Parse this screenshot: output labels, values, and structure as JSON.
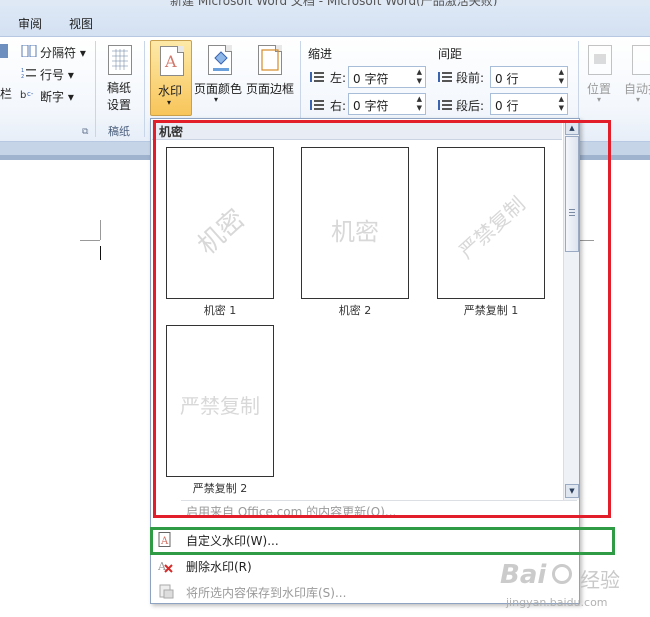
{
  "window": {
    "title": "新建 Microsoft Word 文档 - Microsoft Word(产品激活失败)"
  },
  "tabs": [
    {
      "label": "审阅"
    },
    {
      "label": "视图"
    }
  ],
  "ribbon": {
    "page_setup": {
      "breaks_label": "分隔符",
      "line_numbers_label": "行号",
      "hyphenation_label": "断字",
      "left_fragment": "栏"
    },
    "manuscript": {
      "button_line1": "稿纸",
      "button_line2": "设置",
      "group_label": "稿纸"
    },
    "page_background": {
      "watermark_label": "水印",
      "page_color_label": "页面颜色",
      "page_borders_label": "页面边框"
    },
    "paragraph": {
      "indent_title": "缩进",
      "indent_left_label": "左:",
      "indent_left_value": "0 字符",
      "indent_right_label": "右:",
      "indent_right_value": "0 字符",
      "spacing_title": "间距",
      "spacing_before_label": "段前:",
      "spacing_before_value": "0 行",
      "spacing_after_label": "段后:",
      "spacing_after_value": "0 行"
    },
    "arrange": {
      "position_label": "位置",
      "wrap_label": "自动换"
    }
  },
  "watermark_menu": {
    "section_title": "机密",
    "gallery": [
      {
        "watermark_text": "机密",
        "label": "机密 1",
        "style": "diagonal"
      },
      {
        "watermark_text": "机密",
        "label": "机密 2",
        "style": "horizontal"
      },
      {
        "watermark_text": "严禁复制",
        "label": "严禁复制 1",
        "style": "diagonal"
      },
      {
        "watermark_text": "严禁复制",
        "label": "严禁复制 2",
        "style": "horizontal"
      }
    ],
    "items": [
      {
        "label": "启用来自 Office.com 的内容更新(O)...",
        "enabled": false
      },
      {
        "label": "自定义水印(W)...",
        "enabled": true
      },
      {
        "label": "删除水印(R)",
        "enabled": true
      },
      {
        "label": "将所选内容保存到水印库(S)...",
        "enabled": false
      }
    ]
  },
  "site_watermark": {
    "brand": "Bai",
    "brand_cn": "经验",
    "url": "jingyan.baidu.com"
  },
  "colors": {
    "highlight_red": "#e21e2b",
    "highlight_green": "#2f9c45",
    "watermark_button": "#f8c55a",
    "ribbon_tab_bg": "#dde8f6"
  }
}
